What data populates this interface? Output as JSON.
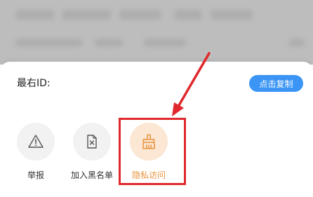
{
  "sheet": {
    "id_label": "最右ID:",
    "copy_button_label": "点击复制"
  },
  "actions": [
    {
      "label": "举报",
      "icon": "warning-icon"
    },
    {
      "label": "加入黑名单",
      "icon": "blocked-file-icon"
    },
    {
      "label": "隐私访问",
      "icon": "broom-icon"
    }
  ],
  "colors": {
    "accent_blue": "#3a95f5",
    "highlight_orange": "#e8923b",
    "annotation_red": "#e0282d"
  }
}
